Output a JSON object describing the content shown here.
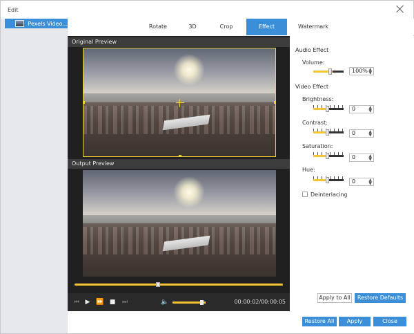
{
  "window": {
    "title": "Edit"
  },
  "sidebar": {
    "file_name": "Pexels Video..."
  },
  "tabs": [
    {
      "label": "Rotate",
      "active": false
    },
    {
      "label": "3D",
      "active": false
    },
    {
      "label": "Crop",
      "active": false
    },
    {
      "label": "Effect",
      "active": true
    },
    {
      "label": "Watermark",
      "active": false
    }
  ],
  "preview": {
    "original_label": "Original Preview",
    "output_label": "Output Preview",
    "progress_fraction": 0.4
  },
  "player": {
    "time": "00:00:02/00:00:05",
    "volume_fraction": 0.9,
    "icons": {
      "prev": "⏮",
      "play": "▶",
      "forward": "⏩",
      "stop": "■",
      "next": "⏭",
      "volume": "🔈"
    }
  },
  "effects": {
    "audio_title": "Audio Effect",
    "volume_label": "Volume:",
    "volume_value": "100%",
    "video_title": "Video Effect",
    "brightness_label": "Brightness:",
    "brightness_value": "0",
    "contrast_label": "Contrast:",
    "contrast_value": "0",
    "saturation_label": "Saturation:",
    "saturation_value": "0",
    "hue_label": "Hue:",
    "hue_value": "0",
    "deinterlacing_label": "Deinterlacing",
    "deinterlacing_checked": false
  },
  "buttons": {
    "apply_to_all": "Apply to All",
    "restore_defaults": "Restore Defaults",
    "restore_all": "Restore All",
    "apply": "Apply",
    "close": "Close"
  },
  "colors": {
    "accent": "#3a8fd8",
    "slider": "#f2c531",
    "crop": "#f2d23a"
  }
}
